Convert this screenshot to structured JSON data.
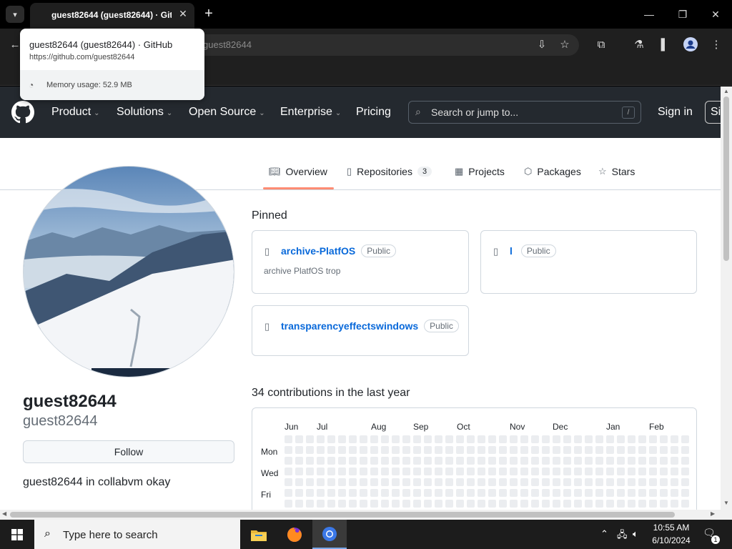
{
  "browser": {
    "tab_title": "guest82644 (guest82644) · GitHub",
    "tab_title_visible": "guest82644 (guest82644) · Git",
    "omnibox_text": "guest82644",
    "tooltip": {
      "title": "guest82644 (guest82644) · GitHub",
      "url": "https://github.com/guest82644",
      "memory": "Memory usage: 52.9 MB"
    }
  },
  "github": {
    "nav": [
      "Product",
      "Solutions",
      "Open Source",
      "Enterprise",
      "Pricing"
    ],
    "search_placeholder": "Search or jump to...",
    "search_key": "/",
    "signin": "Sign in",
    "signup": "Si",
    "tabs": {
      "overview": "Overview",
      "repositories": "Repositories",
      "repositories_count": "3",
      "projects": "Projects",
      "packages": "Packages",
      "stars": "Stars"
    },
    "profile": {
      "name": "guest82644",
      "login": "guest82644",
      "follow": "Follow",
      "bio": "guest82644 in collabvm okay"
    },
    "pinned_heading": "Pinned",
    "pinned": [
      {
        "name": "archive-PlatfOS",
        "badge": "Public",
        "desc": "archive PlatfOS trop"
      },
      {
        "name": "l",
        "badge": "Public",
        "desc": ""
      },
      {
        "name": "transparencyeffectswindows",
        "badge": "Public",
        "desc": ""
      }
    ],
    "contrib_heading": "34 contributions in the last year",
    "months": [
      "Jun",
      "Jul",
      "Aug",
      "Sep",
      "Oct",
      "Nov",
      "Dec",
      "Jan",
      "Feb"
    ],
    "days": [
      "Mon",
      "Wed",
      "Fri"
    ]
  },
  "taskbar": {
    "search_text": "Type here to search",
    "time": "10:55 AM",
    "date": "6/10/2024",
    "notification_count": "1"
  },
  "colors": {
    "gh_header": "#24292f",
    "link": "#0969da",
    "tab_underline": "#fd8c73"
  }
}
